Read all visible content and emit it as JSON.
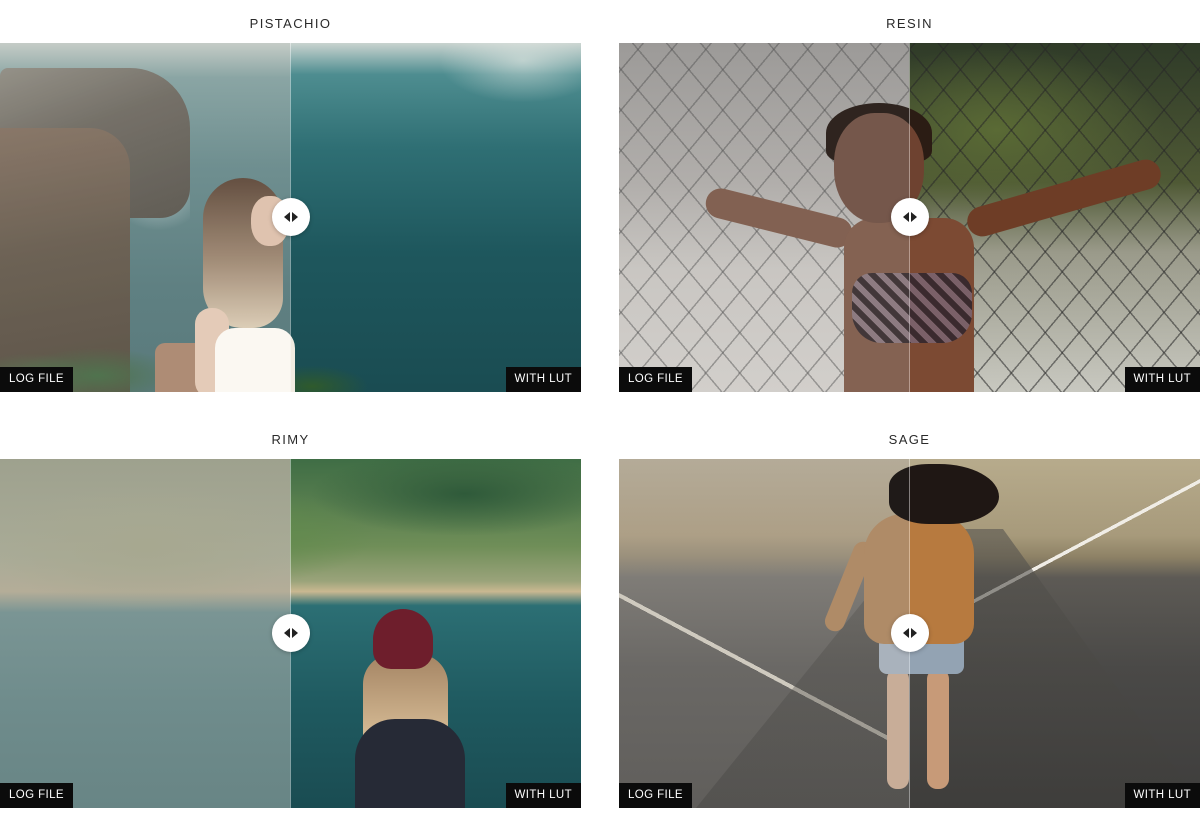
{
  "comparisons": [
    {
      "title": "PISTACHIO",
      "before_label": "LOG FILE",
      "after_label": "WITH LUT",
      "split_percent": 50
    },
    {
      "title": "RESIN",
      "before_label": "LOG FILE",
      "after_label": "WITH LUT",
      "split_percent": 50
    },
    {
      "title": "RIMY",
      "before_label": "LOG FILE",
      "after_label": "WITH LUT",
      "split_percent": 50
    },
    {
      "title": "SAGE",
      "before_label": "LOG FILE",
      "after_label": "WITH LUT",
      "split_percent": 50
    }
  ],
  "handle_icon": "double-arrow-icon"
}
